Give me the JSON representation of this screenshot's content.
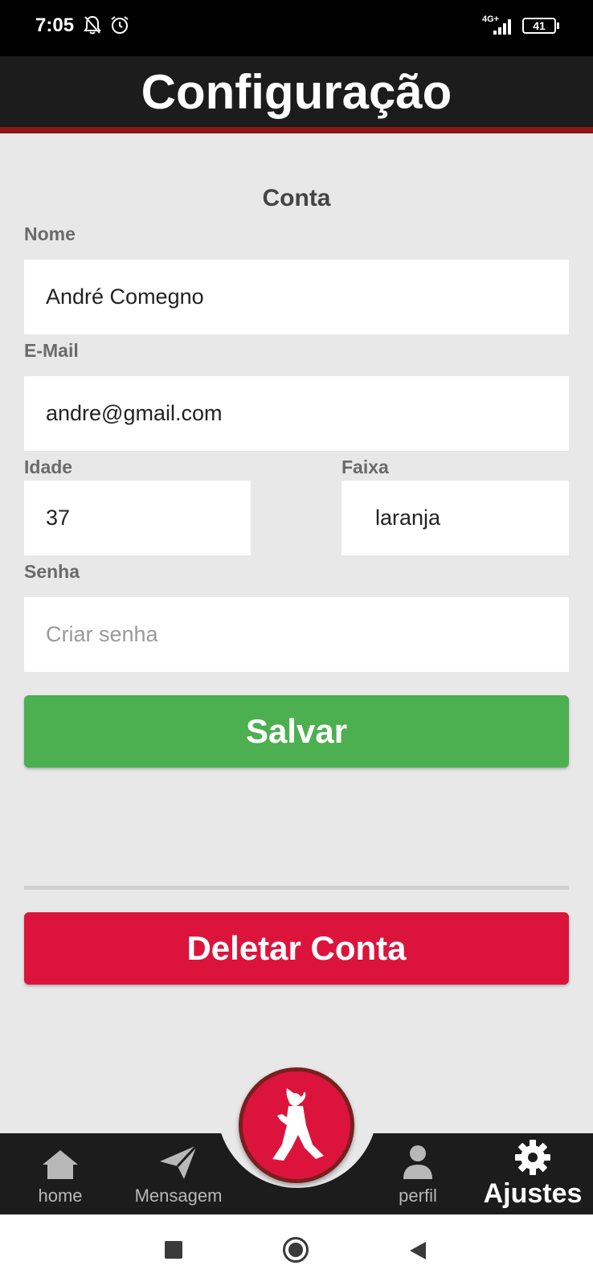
{
  "status_bar": {
    "time": "7:05",
    "network": "4G+",
    "battery": "41",
    "icons": [
      "bell-off-icon",
      "alarm-icon",
      "signal-icon",
      "battery-icon"
    ]
  },
  "header": {
    "title": "Configuração"
  },
  "form": {
    "section_title": "Conta",
    "nome_label": "Nome",
    "nome_value": "André Comegno",
    "email_label": "E-Mail",
    "email_value": "andre@gmail.com",
    "idade_label": "Idade",
    "idade_value": "37",
    "faixa_label": "Faixa",
    "faixa_value": "laranja",
    "senha_label": "Senha",
    "senha_placeholder": "Criar senha",
    "save_label": "Salvar"
  },
  "delete_label": "Deletar Conta",
  "bottom_nav": {
    "items": [
      {
        "label": "home",
        "icon": "home-icon"
      },
      {
        "label": "Mensagem",
        "icon": "paper-plane-icon"
      },
      {
        "label": "perfil",
        "icon": "person-icon"
      },
      {
        "label": "Ajustes",
        "icon": "gear-icon"
      }
    ],
    "center_icon": "karate-fighter-icon"
  },
  "colors": {
    "header_bg": "#1c1c1c",
    "header_accent": "#8f1414",
    "save": "#4caf50",
    "delete": "#dc143c",
    "background": "#e8e8e8"
  }
}
